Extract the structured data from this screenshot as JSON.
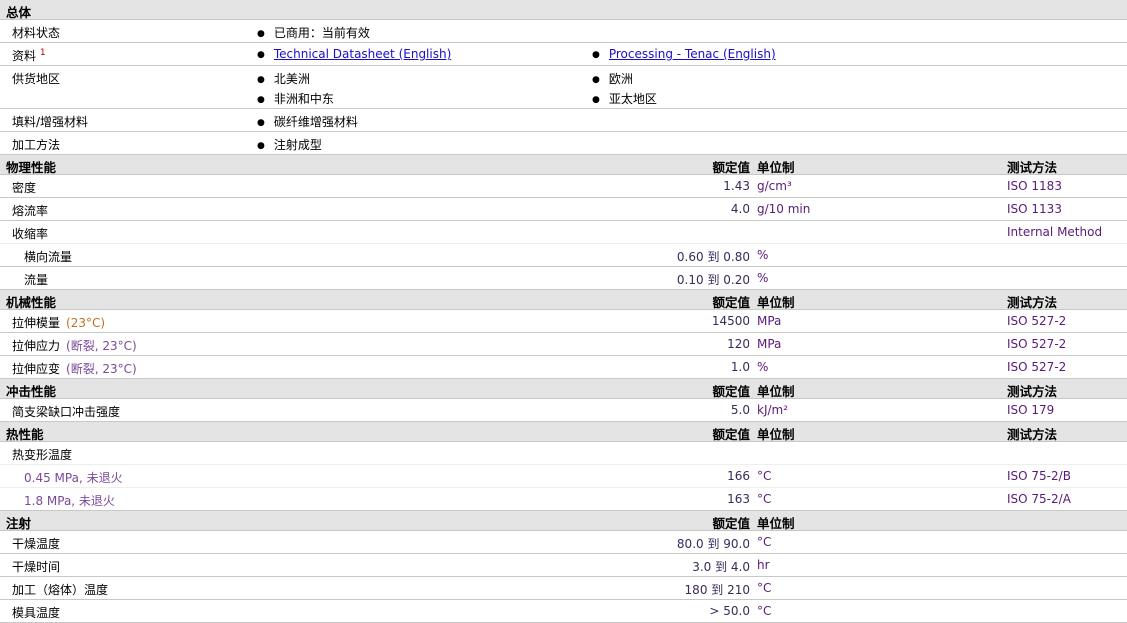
{
  "general": {
    "title": "总体",
    "status_label": "材料状态",
    "status_value": "已商用：当前有效",
    "docs_label": "资料",
    "docs_sup": "1",
    "doc1": "Technical Datasheet (English)",
    "doc2": "Processing - Tenac (English)",
    "region_label": "供货地区",
    "regions": [
      "北美洲",
      "欧洲",
      "非洲和中东",
      "亚太地区"
    ],
    "filler_label": "填料/增强材料",
    "filler_value": "碳纤维增强材料",
    "process_label": "加工方法",
    "process_value": "注射成型"
  },
  "cols": {
    "value": "额定值",
    "unit": "单位制",
    "method": "测试方法"
  },
  "physical": {
    "title": "物理性能",
    "rows": [
      {
        "label": "密度",
        "value": "1.43",
        "unit": "g/cm³",
        "method": "ISO 1183"
      },
      {
        "label": "熔流率",
        "value": "4.0",
        "unit": "g/10 min",
        "method": "ISO 1133"
      },
      {
        "label": "收缩率",
        "method": "Internal Method"
      },
      {
        "label": "横向流量",
        "value": "0.60 到  0.80",
        "unit": "%"
      },
      {
        "label": "流量",
        "value": "0.10 到  0.20",
        "unit": "%"
      }
    ]
  },
  "mechanical": {
    "title": "机械性能",
    "rows": [
      {
        "label": "拉伸模量",
        "cond": "(23°C)",
        "value": "14500",
        "unit": "MPa",
        "method": "ISO 527-2"
      },
      {
        "label": "拉伸应力",
        "cond": "(断裂, 23°C)",
        "value": "120",
        "unit": "MPa",
        "method": "ISO 527-2"
      },
      {
        "label": "拉伸应变",
        "cond": "(断裂, 23°C)",
        "value": "1.0",
        "unit": "%",
        "method": "ISO 527-2"
      }
    ]
  },
  "impact": {
    "title": "冲击性能",
    "rows": [
      {
        "label": "简支梁缺口冲击强度",
        "value": "5.0",
        "unit": "kJ/m²",
        "method": "ISO 179"
      }
    ]
  },
  "thermal": {
    "title": "热性能",
    "rows": [
      {
        "label": "热变形温度"
      },
      {
        "label": "0.45 MPa, 未退火",
        "value": "166",
        "unit": "°C",
        "method": "ISO 75-2/B"
      },
      {
        "label": "1.8 MPa, 未退火",
        "value": "163",
        "unit": "°C",
        "method": "ISO 75-2/A"
      }
    ]
  },
  "injection": {
    "title": "注射",
    "rows": [
      {
        "label": "干燥温度",
        "value": "80.0 到  90.0",
        "unit": "°C"
      },
      {
        "label": "干燥时间",
        "value": "3.0 到  4.0",
        "unit": "hr"
      },
      {
        "label": "加工（熔体）温度",
        "value": "180 到  210",
        "unit": "°C"
      },
      {
        "label": "模具温度",
        "value": "> 50.0",
        "unit": "°C"
      }
    ]
  }
}
